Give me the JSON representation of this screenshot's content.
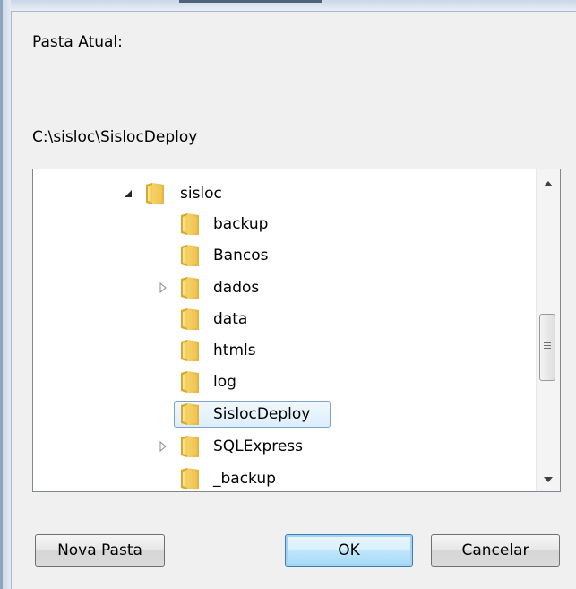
{
  "dialog": {
    "current_folder_label": "Pasta Atual:",
    "current_path": "C:\\sisloc\\SislocDeploy"
  },
  "tree": {
    "items": [
      {
        "label": "sisloc",
        "expander": "expanded"
      },
      {
        "label": "backup",
        "expander": "none"
      },
      {
        "label": "Bancos",
        "expander": "none"
      },
      {
        "label": "dados",
        "expander": "collapsed"
      },
      {
        "label": "data",
        "expander": "none"
      },
      {
        "label": "htmls",
        "expander": "none"
      },
      {
        "label": "log",
        "expander": "none"
      },
      {
        "label": "SislocDeploy",
        "expander": "none",
        "selected": true
      },
      {
        "label": "SQLExpress",
        "expander": "collapsed"
      },
      {
        "label": "_backup",
        "expander": "none"
      }
    ]
  },
  "buttons": {
    "new_folder": "Nova Pasta",
    "ok": "OK",
    "cancel": "Cancelar"
  },
  "colors": {
    "selection_border": "#7da2ce",
    "default_button_border": "#3c7fb1"
  }
}
